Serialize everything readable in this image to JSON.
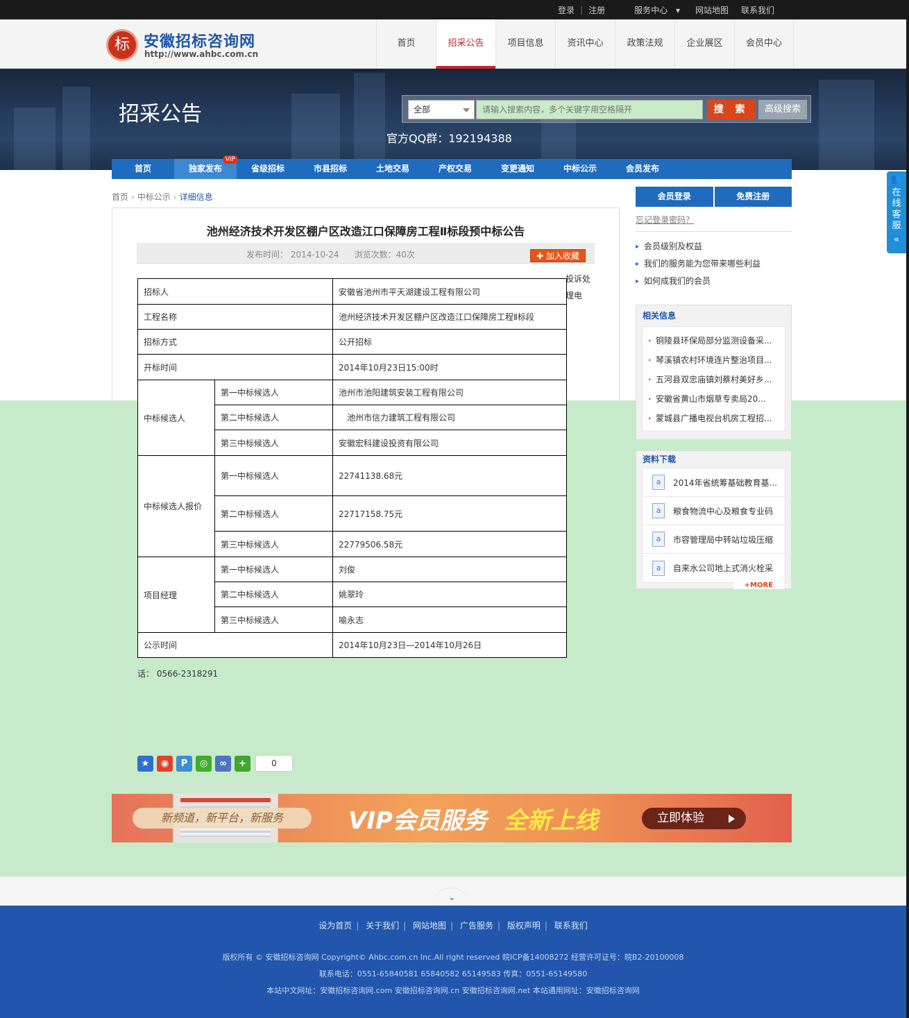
{
  "topbar": {
    "login": "登录",
    "register": "注册",
    "service_center": "服务中心",
    "sitemap": "网站地图",
    "contact": "联系我们"
  },
  "logo": {
    "seal_char": "标",
    "name": "安徽招标咨询网",
    "url": "http://www.ahbc.com.cn"
  },
  "main_nav": [
    "首页",
    "招采公告",
    "项目信息",
    "资讯中心",
    "政策法规",
    "企业展区",
    "会员中心"
  ],
  "banner": {
    "title": "招采公告",
    "search_category": "全部",
    "search_placeholder": "请输入搜索内容，多个关键字用空格隔开",
    "search_button": "搜 索",
    "advanced_button": "高级搜索",
    "qq_group": "官方QQ群：192194388"
  },
  "sub_nav": [
    "首页",
    "独家发布",
    "省级招标",
    "市县招标",
    "土地交易",
    "产权交易",
    "变更通知",
    "中标公示",
    "会员发布"
  ],
  "sub_nav_vip_badge": "VIP",
  "breadcrumb": [
    "首页",
    "中标公示",
    "详细信息"
  ],
  "article": {
    "title": "池州经济技术开发区棚户区改造江口保障房工程Ⅱ标段预中标公告",
    "publish_time": "发布时间： 2014-10-24",
    "views": "浏览次数：40次",
    "favorite_button": "加入收藏",
    "side_text_1": "投诉处",
    "side_text_2": "理电",
    "phone_label": "话：",
    "phone": "0566-2318291",
    "share_count": "0"
  },
  "bid_table": {
    "tenderer_label": "招标人",
    "tenderer": "安徽省池州市平天湖建设工程有限公司",
    "project_label": "工程名称",
    "project": "池州经济技术开发区棚户区改造江口保障房工程Ⅱ标段",
    "method_label": "招标方式",
    "method": "公开招标",
    "open_label": "开标时间",
    "open_time": "2014年10月23日15:00时",
    "candidates_label": "中标候选人",
    "prices_label": "中标候选人报价",
    "managers_label": "项目经理",
    "first": "第一中标候选人",
    "second": "第二中标候选人",
    "third": "第三中标候选人",
    "candidates": [
      "池州市池阳建筑安装工程有限公司",
      "　池州市信力建筑工程有限公司",
      "安徽宏科建设投资有限公司"
    ],
    "prices": [
      "22741138.68元",
      "22717158.75元",
      "22779506.58元"
    ],
    "managers": [
      "刘俊",
      "姚翠玲",
      "喻永志"
    ],
    "notice_label": "公示时间",
    "notice_period": "2014年10月23日—2014年10月26日"
  },
  "sidebar": {
    "member_login": "会员登录",
    "free_register": "免费注册",
    "forgot_password": "忘记登录密码？",
    "member_links": [
      "会员级别及权益",
      "我们的服务能为您带来哪些利益",
      "如何成我们的会员"
    ],
    "related_title": "相关信息",
    "related": [
      "铜陵县环保局部分监测设备采...",
      "琴溪镇农村环境连片整治项目...",
      "五河县双忠庙镇刘蔡村美好乡...",
      "安徽省黄山市烟草专卖局20...",
      "蒙城县广播电视台机房工程招..."
    ],
    "downloads_title": "资料下载",
    "downloads": [
      "2014年省统筹基础教育基...",
      "粮食物流中心及粮食专业码",
      "市容管理局中转站垃圾压缩",
      "自来水公司地上式消火栓采"
    ],
    "more": "+MORE"
  },
  "vip_banner": {
    "slogan": "新频道，新平台，新服务",
    "title_white": "VIP会员服务",
    "title_yellow": "全新上线",
    "button": "立即体验"
  },
  "float_service": "在线客服",
  "footer": {
    "links": [
      "设为首页",
      "关于我们",
      "网站地图",
      "广告服务",
      "版权声明",
      "联系我们"
    ],
    "copyright": "版权所有 © 安徽招标咨询网 Copyright© Ahbc.com.cn Inc.All right reserved 皖ICP备14008272 经营许可证号：皖B2-20100008",
    "phones": "联系电话：0551-65840581 65840582 65149583 传真：0551-65149580",
    "domains": "本站中文网址：安徽招标咨询网.com 安徽招标咨询网.cn 安徽招标咨询网.net 本站通用网址：安徽招标咨询网"
  },
  "colors": {
    "brand_blue": "#1f6bbd",
    "accent_red": "#c0282f",
    "band_green": "#c7ebca",
    "footer_blue": "#2156ac"
  }
}
